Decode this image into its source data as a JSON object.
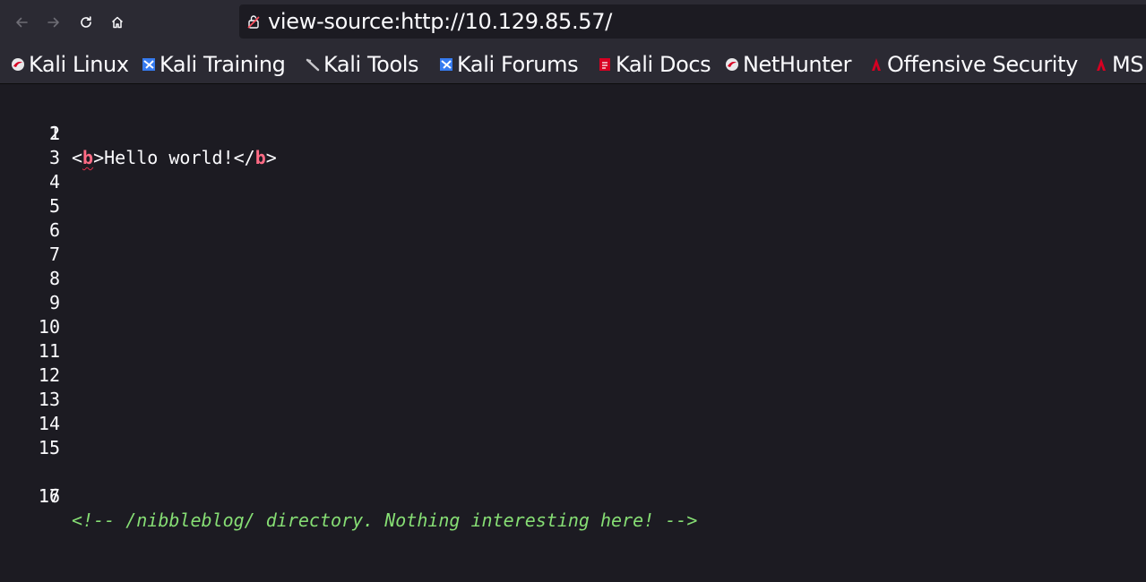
{
  "browser": {
    "url": "view-source:http://10.129.85.57/",
    "nav": {
      "back_icon": "arrow-left-icon",
      "forward_icon": "arrow-right-icon",
      "reload_icon": "reload-icon",
      "home_icon": "home-icon"
    },
    "bookmarks": [
      {
        "label": "Kali Linux",
        "icon": "kali-dragon-icon"
      },
      {
        "label": "Kali Training",
        "icon": "kali-training-icon"
      },
      {
        "label": "Kali Tools",
        "icon": "kali-tools-icon"
      },
      {
        "label": "Kali Forums",
        "icon": "kali-forums-icon"
      },
      {
        "label": "Kali Docs",
        "icon": "kali-docs-icon"
      },
      {
        "label": "NetHunter",
        "icon": "nethunter-icon"
      },
      {
        "label": "Offensive Security",
        "icon": "offsec-icon"
      },
      {
        "label": "MS",
        "icon": "offsec-icon"
      }
    ]
  },
  "source": {
    "line_numbers": [
      "1",
      "2",
      "3",
      "4",
      "5",
      "6",
      "7",
      "8",
      "9",
      "10",
      "11",
      "12",
      "13",
      "14",
      "15",
      "16",
      "17"
    ],
    "line1": {
      "open_lt": "<",
      "open_tag": "b",
      "open_gt": ">",
      "text": "Hello world!",
      "close_lt": "</",
      "close_tag": "b",
      "close_gt": ">"
    },
    "line16_comment": "<!-- /nibbleblog/ directory. Nothing interesting here! -->"
  },
  "colors": {
    "toolbar_bg": "#2b2a33",
    "page_bg": "#1c1b22",
    "tag_color": "#ff6b85",
    "comment_color": "#86de74",
    "text_color": "#fbfbfe"
  }
}
